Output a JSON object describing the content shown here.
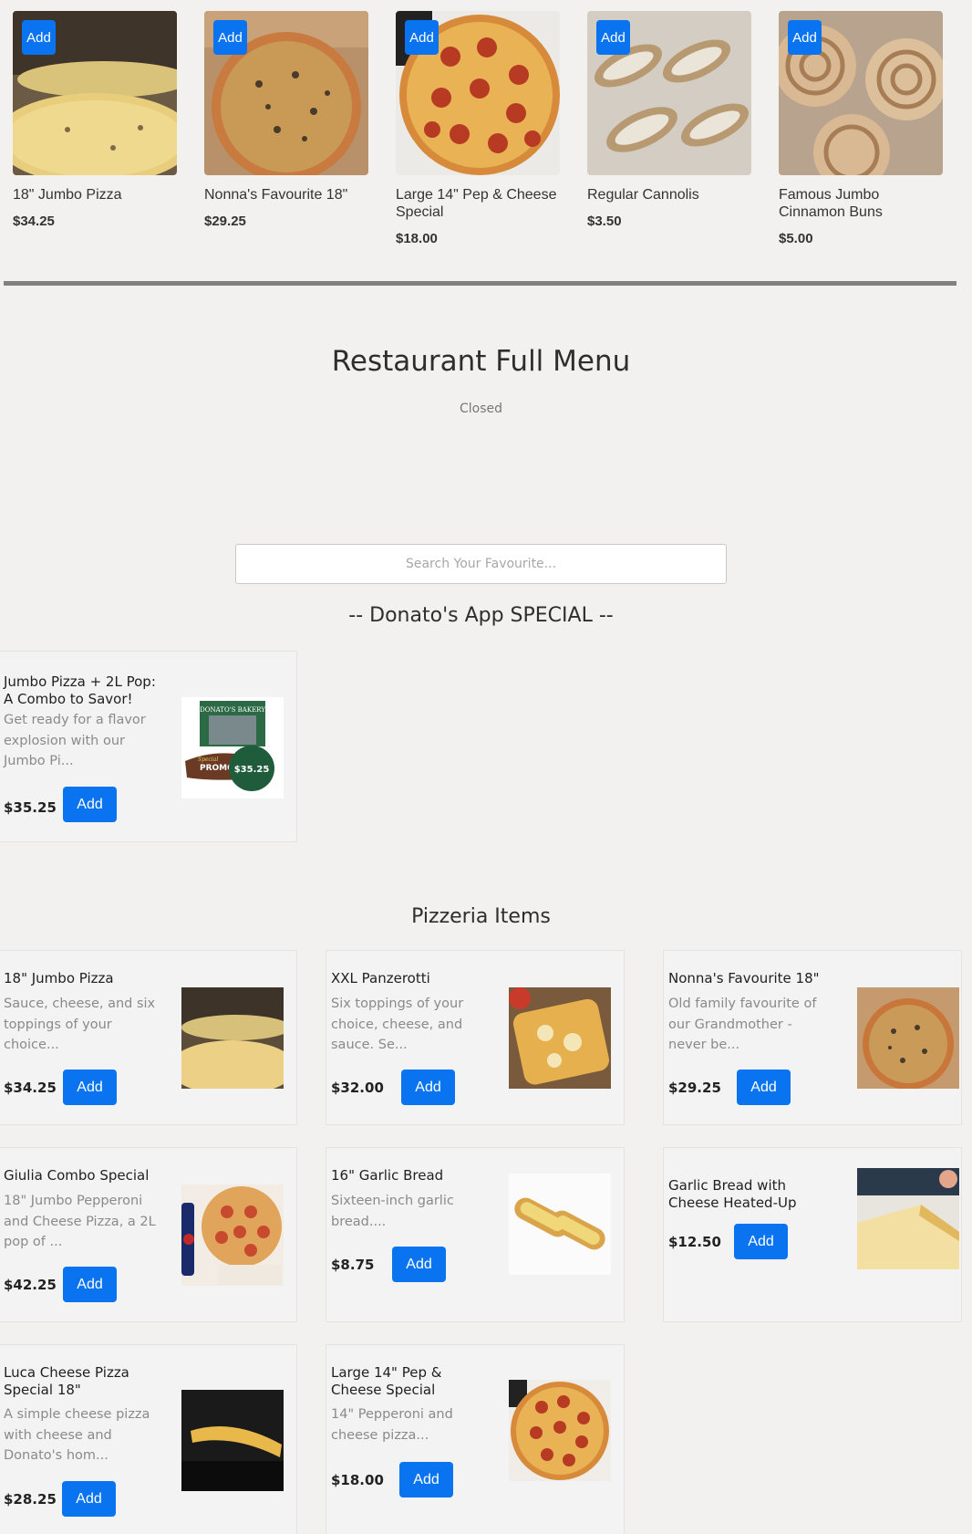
{
  "featured": [
    {
      "name": "18\" Jumbo Pizza",
      "price": "$34.25",
      "add_label": "Add"
    },
    {
      "name": "Nonna's Favourite 18\"",
      "price": "$29.25",
      "add_label": "Add"
    },
    {
      "name": "Large 14\" Pep & Cheese Special",
      "price": "$18.00",
      "add_label": "Add"
    },
    {
      "name": "Regular Cannolis",
      "price": "$3.50",
      "add_label": "Add"
    },
    {
      "name": "Famous Jumbo Cinnamon Buns",
      "price": "$5.00",
      "add_label": "Add"
    }
  ],
  "menu": {
    "title": "Restaurant Full Menu",
    "status": "Closed",
    "search_placeholder": "Search Your Favourite..."
  },
  "sections": {
    "special_title": "-- Donato's App SPECIAL --",
    "pizzeria_title": "Pizzeria Items"
  },
  "special_items": [
    {
      "name": "Jumbo Pizza + 2L Pop: A Combo to Savor!",
      "desc": "Get ready for a flavor explosion with our Jumbo Pi...",
      "price": "$35.25",
      "add_label": "Add",
      "promo": {
        "brand": "DONATO'S BAKERY",
        "tag": "Special",
        "label": "PROMO",
        "price": "$35.25"
      }
    }
  ],
  "pizzeria_items": [
    {
      "name": "18\" Jumbo Pizza",
      "desc": "Sauce, cheese, and six toppings of your choice...",
      "price": "$34.25",
      "add_label": "Add"
    },
    {
      "name": "XXL Panzerotti",
      "desc": "Six toppings of your choice, cheese, and sauce. Se...",
      "price": "$32.00",
      "add_label": "Add"
    },
    {
      "name": "Nonna's Favourite 18\"",
      "desc": "Old family favourite of our Grandmother - never be...",
      "price": "$29.25",
      "add_label": "Add"
    },
    {
      "name": "Giulia Combo Special",
      "desc": "18\" Jumbo Pepperoni and Cheese Pizza, a 2L pop of ...",
      "price": "$42.25",
      "add_label": "Add"
    },
    {
      "name": "16\" Garlic Bread",
      "desc": "Sixteen-inch garlic bread....",
      "price": "$8.75",
      "add_label": "Add"
    },
    {
      "name": "Garlic Bread with Cheese Heated-Up",
      "desc": "",
      "price": "$12.50",
      "add_label": "Add"
    },
    {
      "name": "Luca Cheese Pizza Special 18\"",
      "desc": "A simple cheese pizza with cheese and Donato's hom...",
      "price": "$28.25",
      "add_label": "Add"
    },
    {
      "name": "Large 14\" Pep & Cheese Special",
      "desc": "14\" Pepperoni and cheese pizza...",
      "price": "$18.00",
      "add_label": "Add"
    }
  ],
  "colors": {
    "accent": "#0a74f0",
    "page_bg": "#f2f1f0",
    "divider": "#818181"
  }
}
